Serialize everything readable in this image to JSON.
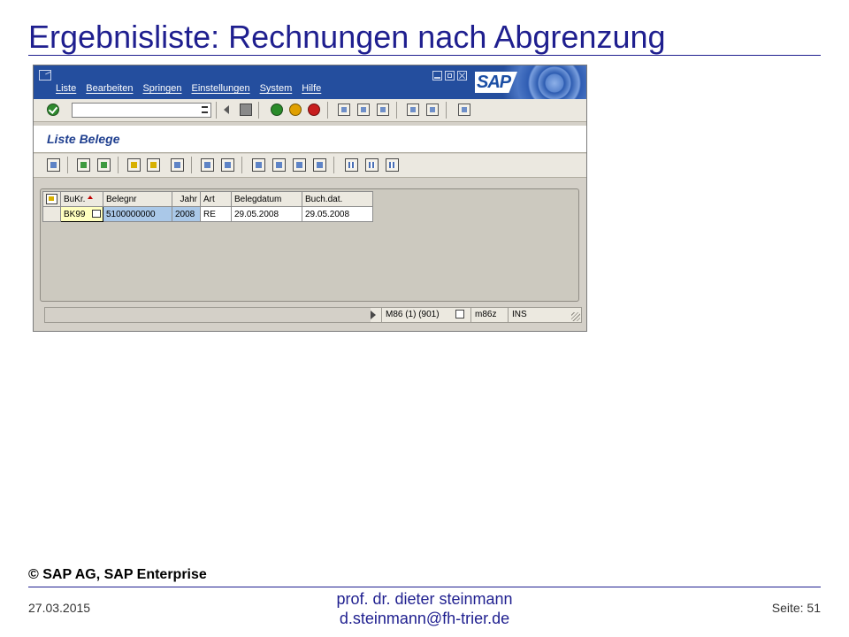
{
  "slide": {
    "title": "Ergebnisliste: Rechnungen nach Abgrenzung",
    "copyright": "© SAP AG, SAP Enterprise",
    "date": "27.03.2015",
    "author_line1": "prof. dr. dieter steinmann",
    "author_line2": "d.steinmann@fh-trier.de",
    "page_label": "Seite: 51"
  },
  "sap": {
    "menu": [
      "Liste",
      "Bearbeiten",
      "Springen",
      "Einstellungen",
      "System",
      "Hilfe"
    ],
    "logo_text": "SAP",
    "command_field_value": "",
    "screen_title": "Liste Belege",
    "table": {
      "columns": [
        "BuKr.",
        "Belegnr",
        "Jahr",
        "Art",
        "Belegdatum",
        "Buch.dat."
      ],
      "rows": [
        [
          "BK99",
          "5100000000",
          "2008",
          "RE",
          "29.05.2008",
          "29.05.2008"
        ]
      ]
    },
    "status": {
      "system": "M86 (1) (901)",
      "server": "m86z",
      "mode": "INS"
    }
  }
}
